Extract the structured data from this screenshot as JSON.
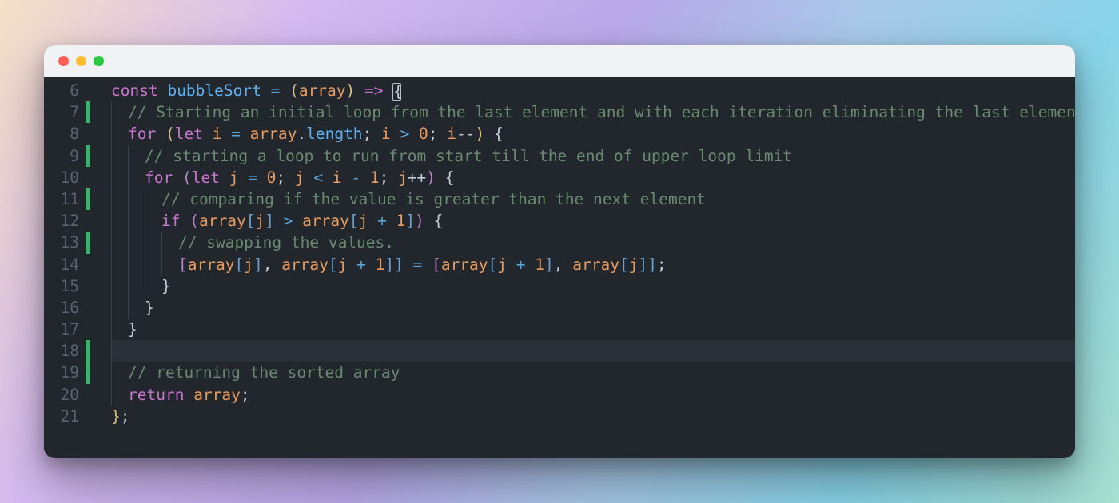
{
  "window": {
    "traffic_lights": [
      "close",
      "minimize",
      "zoom"
    ]
  },
  "editor": {
    "first_line_number": 6,
    "modified_lines": [
      7,
      9,
      11,
      13,
      18,
      19
    ],
    "current_line": 18,
    "lines": [
      {
        "n": 6,
        "indent_guides": 0,
        "lead_spaces": 0,
        "tokens": [
          {
            "t": "const ",
            "c": "kw"
          },
          {
            "t": "bubbleSort ",
            "c": "fn"
          },
          {
            "t": "= ",
            "c": "opc"
          },
          {
            "t": "(",
            "c": "brk"
          },
          {
            "t": "array",
            "c": "var"
          },
          {
            "t": ") ",
            "c": "brk"
          },
          {
            "t": "=> ",
            "c": "kw"
          },
          {
            "t": "{",
            "c": "cursorbox"
          }
        ]
      },
      {
        "n": 7,
        "indent_guides": 1,
        "lead_spaces": 1,
        "tokens": [
          {
            "t": "// Starting an initial loop from the last element and with each iteration eliminating the last element",
            "c": "cmt"
          }
        ]
      },
      {
        "n": 8,
        "indent_guides": 1,
        "lead_spaces": 1,
        "tokens": [
          {
            "t": "for ",
            "c": "kw"
          },
          {
            "t": "(",
            "c": "brk"
          },
          {
            "t": "let ",
            "c": "kw"
          },
          {
            "t": "i ",
            "c": "var"
          },
          {
            "t": "= ",
            "c": "opc"
          },
          {
            "t": "array",
            "c": "var"
          },
          {
            "t": ".",
            "c": "pun"
          },
          {
            "t": "length",
            "c": "prop"
          },
          {
            "t": "; ",
            "c": "pun"
          },
          {
            "t": "i ",
            "c": "var"
          },
          {
            "t": "> ",
            "c": "opc"
          },
          {
            "t": "0",
            "c": "num"
          },
          {
            "t": "; ",
            "c": "pun"
          },
          {
            "t": "i",
            "c": "var"
          },
          {
            "t": "--",
            "c": "pun"
          },
          {
            "t": ")",
            "c": "brk"
          },
          {
            "t": " {",
            "c": "pun"
          }
        ]
      },
      {
        "n": 9,
        "indent_guides": 2,
        "lead_spaces": 2,
        "tokens": [
          {
            "t": "// starting a loop to run from start till the end of upper loop limit",
            "c": "cmt"
          }
        ]
      },
      {
        "n": 10,
        "indent_guides": 2,
        "lead_spaces": 2,
        "tokens": [
          {
            "t": "for ",
            "c": "kw"
          },
          {
            "t": "(",
            "c": "brk2"
          },
          {
            "t": "let ",
            "c": "kw"
          },
          {
            "t": "j ",
            "c": "var"
          },
          {
            "t": "= ",
            "c": "opc"
          },
          {
            "t": "0",
            "c": "num"
          },
          {
            "t": "; ",
            "c": "pun"
          },
          {
            "t": "j ",
            "c": "var"
          },
          {
            "t": "< ",
            "c": "opc"
          },
          {
            "t": "i ",
            "c": "var"
          },
          {
            "t": "- ",
            "c": "opc"
          },
          {
            "t": "1",
            "c": "num"
          },
          {
            "t": "; ",
            "c": "pun"
          },
          {
            "t": "j",
            "c": "var"
          },
          {
            "t": "++",
            "c": "pun"
          },
          {
            "t": ")",
            "c": "brk2"
          },
          {
            "t": " {",
            "c": "pun"
          }
        ]
      },
      {
        "n": 11,
        "indent_guides": 3,
        "lead_spaces": 3,
        "tokens": [
          {
            "t": "// comparing if the value is greater than the next element",
            "c": "cmt"
          }
        ]
      },
      {
        "n": 12,
        "indent_guides": 3,
        "lead_spaces": 3,
        "tokens": [
          {
            "t": "if ",
            "c": "kw"
          },
          {
            "t": "(",
            "c": "brk2"
          },
          {
            "t": "array",
            "c": "var"
          },
          {
            "t": "[",
            "c": "brk3"
          },
          {
            "t": "j",
            "c": "var"
          },
          {
            "t": "]",
            "c": "brk3"
          },
          {
            "t": " > ",
            "c": "opc"
          },
          {
            "t": "array",
            "c": "var"
          },
          {
            "t": "[",
            "c": "brk3"
          },
          {
            "t": "j ",
            "c": "var"
          },
          {
            "t": "+ ",
            "c": "opc"
          },
          {
            "t": "1",
            "c": "num"
          },
          {
            "t": "]",
            "c": "brk3"
          },
          {
            "t": ")",
            "c": "brk2"
          },
          {
            "t": " {",
            "c": "pun"
          }
        ]
      },
      {
        "n": 13,
        "indent_guides": 4,
        "lead_spaces": 4,
        "tokens": [
          {
            "t": "// swapping the values.",
            "c": "cmt"
          }
        ]
      },
      {
        "n": 14,
        "indent_guides": 4,
        "lead_spaces": 4,
        "tokens": [
          {
            "t": "[",
            "c": "brk2"
          },
          {
            "t": "array",
            "c": "var"
          },
          {
            "t": "[",
            "c": "brk3"
          },
          {
            "t": "j",
            "c": "var"
          },
          {
            "t": "]",
            "c": "brk3"
          },
          {
            "t": ", ",
            "c": "pun"
          },
          {
            "t": "array",
            "c": "var"
          },
          {
            "t": "[",
            "c": "brk3"
          },
          {
            "t": "j ",
            "c": "var"
          },
          {
            "t": "+ ",
            "c": "opc"
          },
          {
            "t": "1",
            "c": "num"
          },
          {
            "t": "]]",
            "c": "brk3"
          },
          {
            "t": " = ",
            "c": "opc"
          },
          {
            "t": "[",
            "c": "brk2"
          },
          {
            "t": "array",
            "c": "var"
          },
          {
            "t": "[",
            "c": "brk3"
          },
          {
            "t": "j ",
            "c": "var"
          },
          {
            "t": "+ ",
            "c": "opc"
          },
          {
            "t": "1",
            "c": "num"
          },
          {
            "t": "]",
            "c": "brk3"
          },
          {
            "t": ", ",
            "c": "pun"
          },
          {
            "t": "array",
            "c": "var"
          },
          {
            "t": "[",
            "c": "brk3"
          },
          {
            "t": "j",
            "c": "var"
          },
          {
            "t": "]]",
            "c": "brk3"
          },
          {
            "t": ";",
            "c": "pun"
          }
        ]
      },
      {
        "n": 15,
        "indent_guides": 3,
        "lead_spaces": 3,
        "tokens": [
          {
            "t": "}",
            "c": "pun"
          }
        ]
      },
      {
        "n": 16,
        "indent_guides": 2,
        "lead_spaces": 2,
        "tokens": [
          {
            "t": "}",
            "c": "pun"
          }
        ]
      },
      {
        "n": 17,
        "indent_guides": 1,
        "lead_spaces": 1,
        "tokens": [
          {
            "t": "}",
            "c": "pun"
          }
        ]
      },
      {
        "n": 18,
        "indent_guides": 1,
        "lead_spaces": 0,
        "tokens": []
      },
      {
        "n": 19,
        "indent_guides": 1,
        "lead_spaces": 1,
        "tokens": [
          {
            "t": "// returning the sorted array",
            "c": "cmt"
          }
        ]
      },
      {
        "n": 20,
        "indent_guides": 1,
        "lead_spaces": 1,
        "tokens": [
          {
            "t": "return ",
            "c": "kw"
          },
          {
            "t": "array",
            "c": "var"
          },
          {
            "t": ";",
            "c": "pun"
          }
        ]
      },
      {
        "n": 21,
        "indent_guides": 0,
        "lead_spaces": 0,
        "tokens": [
          {
            "t": "}",
            "c": "brk"
          },
          {
            "t": ";",
            "c": "pun"
          }
        ]
      }
    ]
  }
}
